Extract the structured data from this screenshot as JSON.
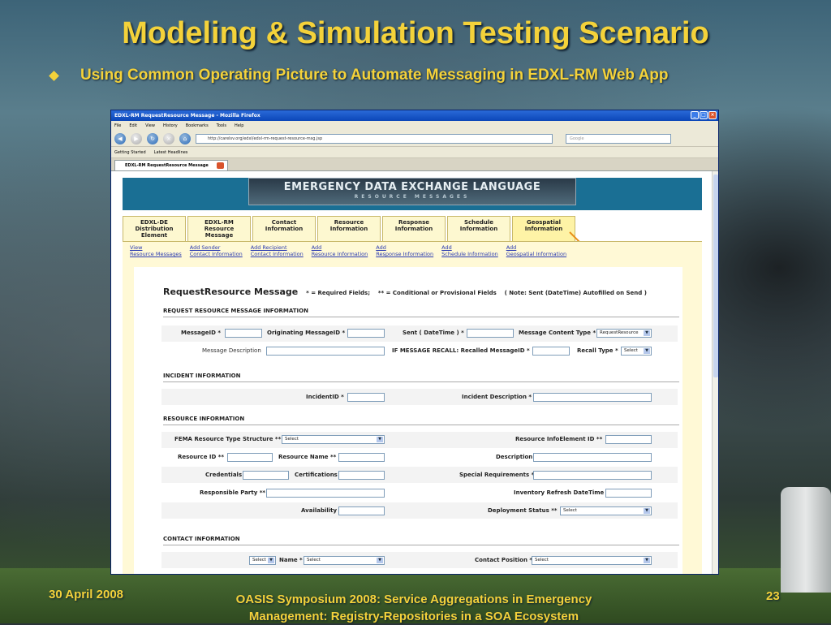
{
  "slide": {
    "title": "Modeling & Simulation Testing Scenario",
    "bullet": "Using Common Operating Picture to Automate Messaging in EDXL-RM Web App",
    "footer_date": "30 April 2008",
    "footer_line1": "OASIS Symposium 2008: Service Aggregations in Emergency",
    "footer_line2": "Management: Registry-Repositories in a SOA Ecosystem",
    "page_number": "23"
  },
  "browser": {
    "window_title": "EDXL-RM RequestResource Message - Mozilla Firefox",
    "menu": [
      "File",
      "Edit",
      "View",
      "History",
      "Bookmarks",
      "Tools",
      "Help"
    ],
    "url": "http://carelsv.org/edxl/edxl-rm-request-resource-msg.jsp",
    "search_placeholder": "Google",
    "bookmarks": [
      "Getting Started",
      "Latest Headlines"
    ],
    "tab_label": "EDXL-RM RequestResource Message"
  },
  "app": {
    "banner_title": "EMERGENCY DATA EXCHANGE LANGUAGE",
    "banner_subtitle": "RESOURCE MESSAGES",
    "tabs": [
      {
        "l1": "EDXL-DE",
        "l2": "Distribution",
        "l3": "Element"
      },
      {
        "l1": "EDXL-RM",
        "l2": "Resource",
        "l3": "Message"
      },
      {
        "l1": "Contact",
        "l2": "Information",
        "l3": ""
      },
      {
        "l1": "Resource",
        "l2": "Information",
        "l3": ""
      },
      {
        "l1": "Response",
        "l2": "Information",
        "l3": ""
      },
      {
        "l1": "Schedule",
        "l2": "Information",
        "l3": ""
      },
      {
        "l1": "Geospatial",
        "l2": "Information",
        "l3": ""
      }
    ],
    "subnav": [
      {
        "l1": "View",
        "l2": "Resource Messages"
      },
      {
        "l1": "Add Sender",
        "l2": "Contact Information"
      },
      {
        "l1": "Add Recipient",
        "l2": "Contact Information"
      },
      {
        "l1": "Add",
        "l2": "Resource Information"
      },
      {
        "l1": "Add",
        "l2": "Response Information"
      },
      {
        "l1": "Add",
        "l2": "Schedule Information"
      },
      {
        "l1": "Add",
        "l2": "Geospatial Information"
      }
    ],
    "form": {
      "heading": "RequestResource Message",
      "note_req": "* = Required Fields;",
      "note_cond": "** = Conditional or Provisional Fields",
      "note_sent": "( Note: Sent (DateTime) Autofilled on Send )",
      "sections": {
        "request": "REQUEST RESOURCE MESSAGE INFORMATION",
        "incident": "INCIDENT INFORMATION",
        "resource": "RESOURCE INFORMATION",
        "contact": "CONTACT INFORMATION"
      },
      "labels": {
        "message_id": "MessageID *",
        "orig_message_id": "Originating MessageID *",
        "sent": "Sent ( DateTime ) *",
        "content_type": "Message Content Type *",
        "message_desc": "Message Description",
        "recalled_id": "IF MESSAGE RECALL: Recalled MessageID *",
        "recall_type": "Recall Type *",
        "incident_id": "IncidentID *",
        "incident_desc": "Incident Description *",
        "fema": "FEMA Resource Type Structure **",
        "info_element_id": "Resource InfoElement ID **",
        "resource_id": "Resource ID **",
        "resource_name": "Resource Name **",
        "description": "Description",
        "credentials": "Credentials",
        "certifications": "Certifications",
        "special_req": "Special Requirements *",
        "responsible": "Responsible Party **",
        "inventory": "Inventory Refresh DateTime",
        "availability": "Availability",
        "deployment": "Deployment Status **",
        "name": "Name *",
        "contact_position": "Contact Position *"
      },
      "selects": {
        "content_type": "RequestResource",
        "recall_type": "Select",
        "fema": "Select",
        "deployment": "Select",
        "contact_prefix": "Select",
        "name": "Select",
        "contact_position": "Select"
      }
    }
  }
}
